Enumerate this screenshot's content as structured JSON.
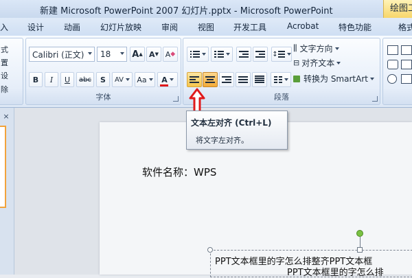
{
  "window": {
    "title": "新建 Microsoft PowerPoint 2007 幻灯片.pptx - Microsoft PowerPoint",
    "context_tab": "绘图工"
  },
  "tabs": [
    "入",
    "设计",
    "动画",
    "幻灯片放映",
    "审阅",
    "视图",
    "开发工具",
    "Acrobat",
    "特色功能",
    "格式"
  ],
  "ribbon": {
    "slides_group": {
      "items": [
        "式",
        "置",
        "设",
        "除"
      ]
    },
    "font_group": {
      "label": "字体",
      "font_name": "Calibri (正文)",
      "font_size": "18",
      "grow_font": "A",
      "shrink_font": "A",
      "clear_format": "A",
      "bold": "B",
      "italic": "I",
      "underline": "U",
      "strikethrough": "abc",
      "shadow": "S",
      "spacing": "AV",
      "change_case": "Aa",
      "font_color": "A"
    },
    "paragraph_group": {
      "label": "段落",
      "text_direction": "文字方向",
      "align_text": "对齐文本",
      "smartart": "转换为 SmartArt"
    }
  },
  "tooltip": {
    "title": "文本左对齐 (Ctrl+L)",
    "description": "将文字左对齐。"
  },
  "panel": {
    "close": "×"
  },
  "slide": {
    "text": "软件名称：WPS",
    "textbox_line1": "PPT文本框里的字怎么排整齐PPT文本框",
    "textbox_line2": "PPT文本框里的字怎么排"
  },
  "colors": {
    "highlight": "#f6c54c",
    "arrow": "#e0191b",
    "font_color_bar": "#e0191b",
    "selection": "#f2a33b"
  },
  "icons": [
    "grow-font-icon",
    "shrink-font-icon",
    "clear-format-icon",
    "bullets-icon",
    "numbering-icon",
    "decrease-indent-icon",
    "increase-indent-icon",
    "line-spacing-icon",
    "align-left-icon",
    "align-center-icon",
    "align-right-icon",
    "justify-icon",
    "distributed-icon",
    "columns-icon",
    "text-direction-icon",
    "align-text-icon",
    "smartart-icon",
    "shapes-icon",
    "red-arrow-icon",
    "rotate-handle-icon"
  ]
}
